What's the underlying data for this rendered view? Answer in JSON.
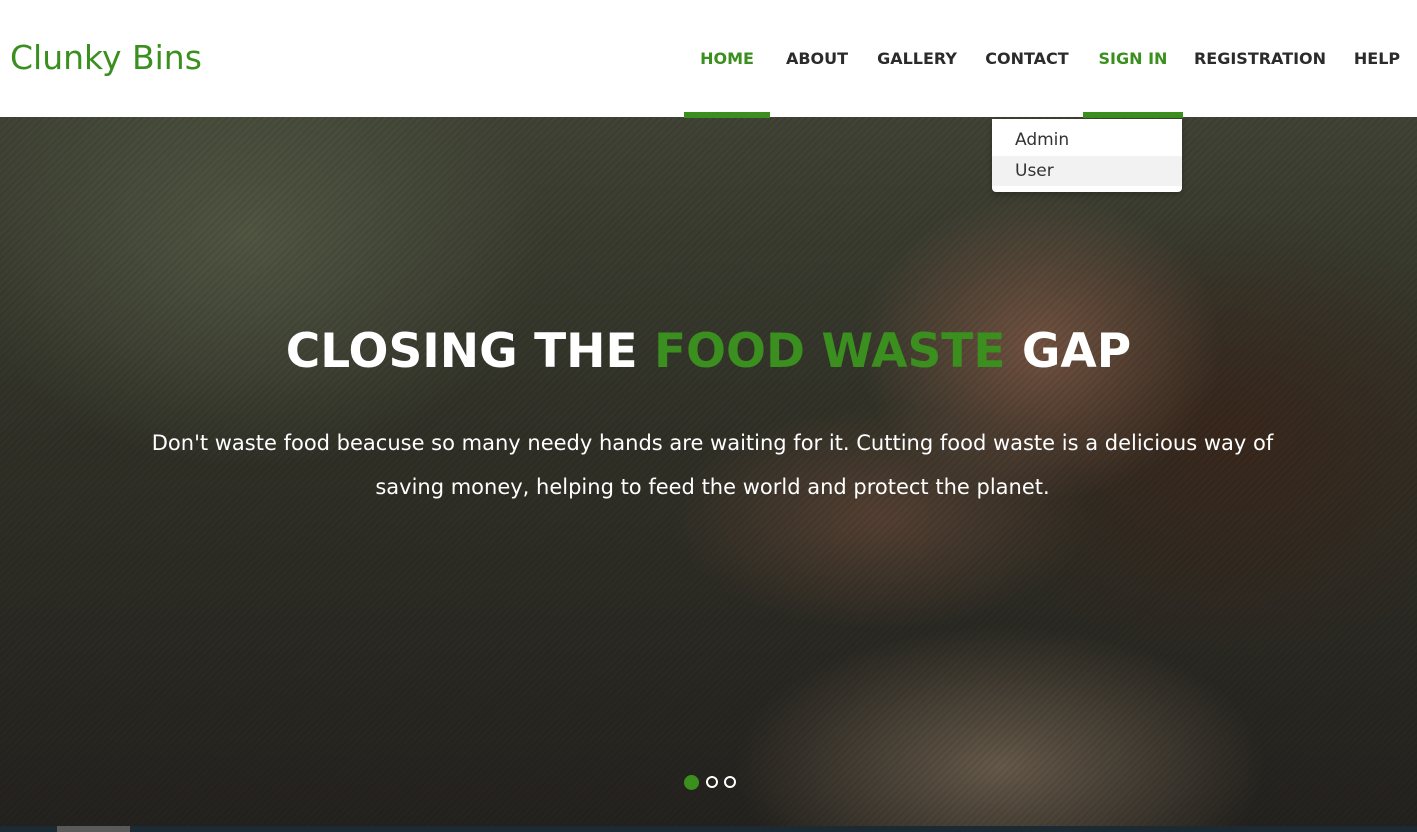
{
  "brand": {
    "name": "Clunky Bins",
    "color": "#3a8f1f"
  },
  "nav": {
    "items": [
      {
        "label": "HOME",
        "active": true
      },
      {
        "label": "ABOUT",
        "active": false
      },
      {
        "label": "GALLERY",
        "active": false
      },
      {
        "label": "CONTACT",
        "active": false
      },
      {
        "label": "SIGN IN",
        "active": true
      },
      {
        "label": "REGISTRATION",
        "active": false
      },
      {
        "label": "HELP",
        "active": false
      }
    ]
  },
  "signin_dropdown": {
    "items": [
      "Admin",
      "User"
    ],
    "hovered": "User"
  },
  "hero": {
    "title_part1": "CLOSING THE",
    "title_highlight": "FOOD WASTE",
    "title_part2": "GAP",
    "subtitle": "Don't waste food beacuse so many needy hands are waiting for it. Cutting food waste is a delicious way of saving money, helping to feed the world and protect the planet.",
    "slides": {
      "count": 3,
      "active": 1
    }
  },
  "colors": {
    "accent": "#3a8f1f",
    "nav_text": "#2b2b2b"
  }
}
